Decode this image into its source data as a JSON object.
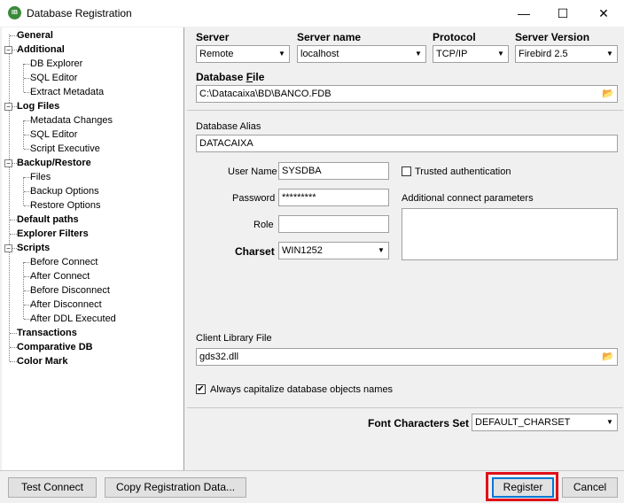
{
  "window": {
    "title": "Database Registration",
    "icon_text": "IB"
  },
  "titlebar_icons": {
    "minimize": "minimize-icon",
    "maximize": "maximize-icon",
    "close": "close-icon"
  },
  "tree": {
    "items": [
      {
        "label": "General",
        "bold": true
      },
      {
        "label": "Additional",
        "bold": true
      },
      {
        "label": "DB Explorer",
        "bold": false
      },
      {
        "label": "SQL Editor",
        "bold": false
      },
      {
        "label": "Extract Metadata",
        "bold": false
      },
      {
        "label": "Log Files",
        "bold": true
      },
      {
        "label": "Metadata Changes",
        "bold": false
      },
      {
        "label": "SQL Editor",
        "bold": false
      },
      {
        "label": "Script Executive",
        "bold": false
      },
      {
        "label": "Backup/Restore",
        "bold": true
      },
      {
        "label": "Files",
        "bold": false
      },
      {
        "label": "Backup Options",
        "bold": false
      },
      {
        "label": "Restore Options",
        "bold": false
      },
      {
        "label": "Default paths",
        "bold": true
      },
      {
        "label": "Explorer Filters",
        "bold": true
      },
      {
        "label": "Scripts",
        "bold": true
      },
      {
        "label": "Before Connect",
        "bold": false
      },
      {
        "label": "After Connect",
        "bold": false
      },
      {
        "label": "Before Disconnect",
        "bold": false
      },
      {
        "label": "After Disconnect",
        "bold": false
      },
      {
        "label": "After DDL Executed",
        "bold": false
      },
      {
        "label": "Transactions",
        "bold": true
      },
      {
        "label": "Comparative DB",
        "bold": true
      },
      {
        "label": "Color Mark",
        "bold": true
      }
    ]
  },
  "server": {
    "label": "Server",
    "value": "Remote"
  },
  "server_name": {
    "label": "Server name",
    "value": "localhost"
  },
  "protocol": {
    "label": "Protocol",
    "value": "TCP/IP"
  },
  "server_version": {
    "label": "Server Version",
    "value": "Firebird 2.5"
  },
  "database_file": {
    "label_prefix": "Database ",
    "label_accel": "F",
    "label_suffix": "ile",
    "value": "C:\\Datacaixa\\BD\\BANCO.FDB"
  },
  "database_alias": {
    "label": "Database Alias",
    "value": "DATACAIXA"
  },
  "user_name": {
    "label": "User Name",
    "value": "SYSDBA"
  },
  "password": {
    "label": "Password",
    "value": "*********"
  },
  "role": {
    "label": "Role",
    "value": ""
  },
  "charset": {
    "label": "Charset",
    "value": "WIN1252"
  },
  "trusted_auth": {
    "label": "Trusted authentication",
    "checked": false
  },
  "additional_params": {
    "label": "Additional connect parameters",
    "value": ""
  },
  "client_library": {
    "label": "Client Library File",
    "value": "gds32.dll"
  },
  "capitalize": {
    "label": "Always capitalize database objects names",
    "checked": true,
    "check_mark": "✔"
  },
  "font_charset": {
    "label": "Font Characters Set",
    "value": "DEFAULT_CHARSET"
  },
  "buttons": {
    "test_connect": "Test Connect",
    "copy_registration": "Copy Registration Data...",
    "register": "Register",
    "cancel": "Cancel"
  },
  "colors": {
    "highlight_border": "#e0101a",
    "focus_border": "#0078d7"
  }
}
